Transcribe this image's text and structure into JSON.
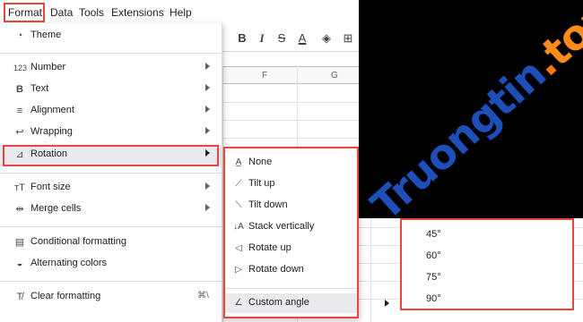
{
  "menubar": {
    "items": [
      "Format",
      "Data",
      "Tools",
      "Extensions",
      "Help"
    ]
  },
  "sheet": {
    "columns": [
      "F",
      "G"
    ],
    "toolbar_icons": [
      "bold-icon",
      "italic-icon",
      "strikethrough-icon",
      "text-color-icon",
      "fill-color-icon",
      "borders-icon"
    ]
  },
  "format_menu": {
    "items": [
      {
        "label": "Theme",
        "icon": "palette-icon"
      },
      {
        "label": "Number",
        "icon": "number-format-icon"
      },
      {
        "label": "Text",
        "icon": "bold-text-icon"
      },
      {
        "label": "Alignment",
        "icon": "alignment-icon"
      },
      {
        "label": "Wrapping",
        "icon": "wrapping-icon"
      },
      {
        "label": "Rotation",
        "icon": "rotation-icon"
      },
      {
        "label": "Font size",
        "icon": "font-size-icon"
      },
      {
        "label": "Merge cells",
        "icon": "merge-cells-icon"
      },
      {
        "label": "Conditional formatting",
        "icon": "conditional-formatting-icon"
      },
      {
        "label": "Alternating colors",
        "icon": "alternating-colors-icon"
      },
      {
        "label": "Clear formatting",
        "icon": "clear-formatting-icon",
        "shortcut": "⌘\\"
      }
    ]
  },
  "rotation_menu": {
    "items": [
      "None",
      "Tilt up",
      "Tilt down",
      "Stack vertically",
      "Rotate up",
      "Rotate down",
      "Custom angle"
    ]
  },
  "angle_menu": {
    "items": [
      "45°",
      "60°",
      "75°",
      "90°"
    ]
  },
  "watermark": {
    "name": "Truongtin",
    "dot": ".",
    "tld": "top"
  },
  "colors": {
    "highlight_border": "#e8453c",
    "hover_bg": "#e8eaed",
    "watermark_blue": "#1e4fb8",
    "watermark_orange": "#ff8c1a"
  }
}
